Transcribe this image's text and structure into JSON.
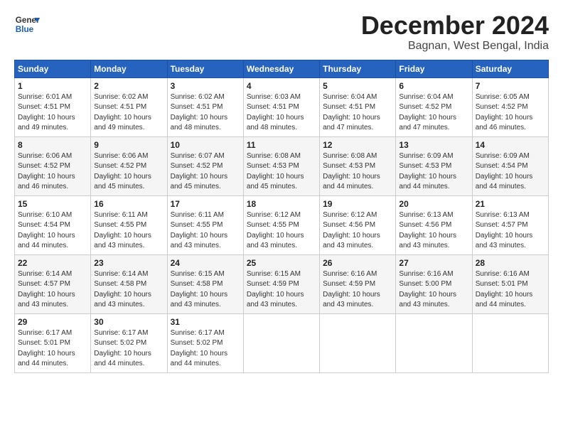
{
  "logo": {
    "line1": "General",
    "line2": "Blue"
  },
  "title": "December 2024",
  "location": "Bagnan, West Bengal, India",
  "days_of_week": [
    "Sunday",
    "Monday",
    "Tuesday",
    "Wednesday",
    "Thursday",
    "Friday",
    "Saturday"
  ],
  "weeks": [
    [
      {
        "day": "1",
        "info": "Sunrise: 6:01 AM\nSunset: 4:51 PM\nDaylight: 10 hours\nand 49 minutes."
      },
      {
        "day": "2",
        "info": "Sunrise: 6:02 AM\nSunset: 4:51 PM\nDaylight: 10 hours\nand 49 minutes."
      },
      {
        "day": "3",
        "info": "Sunrise: 6:02 AM\nSunset: 4:51 PM\nDaylight: 10 hours\nand 48 minutes."
      },
      {
        "day": "4",
        "info": "Sunrise: 6:03 AM\nSunset: 4:51 PM\nDaylight: 10 hours\nand 48 minutes."
      },
      {
        "day": "5",
        "info": "Sunrise: 6:04 AM\nSunset: 4:51 PM\nDaylight: 10 hours\nand 47 minutes."
      },
      {
        "day": "6",
        "info": "Sunrise: 6:04 AM\nSunset: 4:52 PM\nDaylight: 10 hours\nand 47 minutes."
      },
      {
        "day": "7",
        "info": "Sunrise: 6:05 AM\nSunset: 4:52 PM\nDaylight: 10 hours\nand 46 minutes."
      }
    ],
    [
      {
        "day": "8",
        "info": "Sunrise: 6:06 AM\nSunset: 4:52 PM\nDaylight: 10 hours\nand 46 minutes."
      },
      {
        "day": "9",
        "info": "Sunrise: 6:06 AM\nSunset: 4:52 PM\nDaylight: 10 hours\nand 45 minutes."
      },
      {
        "day": "10",
        "info": "Sunrise: 6:07 AM\nSunset: 4:52 PM\nDaylight: 10 hours\nand 45 minutes."
      },
      {
        "day": "11",
        "info": "Sunrise: 6:08 AM\nSunset: 4:53 PM\nDaylight: 10 hours\nand 45 minutes."
      },
      {
        "day": "12",
        "info": "Sunrise: 6:08 AM\nSunset: 4:53 PM\nDaylight: 10 hours\nand 44 minutes."
      },
      {
        "day": "13",
        "info": "Sunrise: 6:09 AM\nSunset: 4:53 PM\nDaylight: 10 hours\nand 44 minutes."
      },
      {
        "day": "14",
        "info": "Sunrise: 6:09 AM\nSunset: 4:54 PM\nDaylight: 10 hours\nand 44 minutes."
      }
    ],
    [
      {
        "day": "15",
        "info": "Sunrise: 6:10 AM\nSunset: 4:54 PM\nDaylight: 10 hours\nand 44 minutes."
      },
      {
        "day": "16",
        "info": "Sunrise: 6:11 AM\nSunset: 4:55 PM\nDaylight: 10 hours\nand 43 minutes."
      },
      {
        "day": "17",
        "info": "Sunrise: 6:11 AM\nSunset: 4:55 PM\nDaylight: 10 hours\nand 43 minutes."
      },
      {
        "day": "18",
        "info": "Sunrise: 6:12 AM\nSunset: 4:55 PM\nDaylight: 10 hours\nand 43 minutes."
      },
      {
        "day": "19",
        "info": "Sunrise: 6:12 AM\nSunset: 4:56 PM\nDaylight: 10 hours\nand 43 minutes."
      },
      {
        "day": "20",
        "info": "Sunrise: 6:13 AM\nSunset: 4:56 PM\nDaylight: 10 hours\nand 43 minutes."
      },
      {
        "day": "21",
        "info": "Sunrise: 6:13 AM\nSunset: 4:57 PM\nDaylight: 10 hours\nand 43 minutes."
      }
    ],
    [
      {
        "day": "22",
        "info": "Sunrise: 6:14 AM\nSunset: 4:57 PM\nDaylight: 10 hours\nand 43 minutes."
      },
      {
        "day": "23",
        "info": "Sunrise: 6:14 AM\nSunset: 4:58 PM\nDaylight: 10 hours\nand 43 minutes."
      },
      {
        "day": "24",
        "info": "Sunrise: 6:15 AM\nSunset: 4:58 PM\nDaylight: 10 hours\nand 43 minutes."
      },
      {
        "day": "25",
        "info": "Sunrise: 6:15 AM\nSunset: 4:59 PM\nDaylight: 10 hours\nand 43 minutes."
      },
      {
        "day": "26",
        "info": "Sunrise: 6:16 AM\nSunset: 4:59 PM\nDaylight: 10 hours\nand 43 minutes."
      },
      {
        "day": "27",
        "info": "Sunrise: 6:16 AM\nSunset: 5:00 PM\nDaylight: 10 hours\nand 43 minutes."
      },
      {
        "day": "28",
        "info": "Sunrise: 6:16 AM\nSunset: 5:01 PM\nDaylight: 10 hours\nand 44 minutes."
      }
    ],
    [
      {
        "day": "29",
        "info": "Sunrise: 6:17 AM\nSunset: 5:01 PM\nDaylight: 10 hours\nand 44 minutes."
      },
      {
        "day": "30",
        "info": "Sunrise: 6:17 AM\nSunset: 5:02 PM\nDaylight: 10 hours\nand 44 minutes."
      },
      {
        "day": "31",
        "info": "Sunrise: 6:17 AM\nSunset: 5:02 PM\nDaylight: 10 hours\nand 44 minutes."
      },
      null,
      null,
      null,
      null
    ]
  ]
}
